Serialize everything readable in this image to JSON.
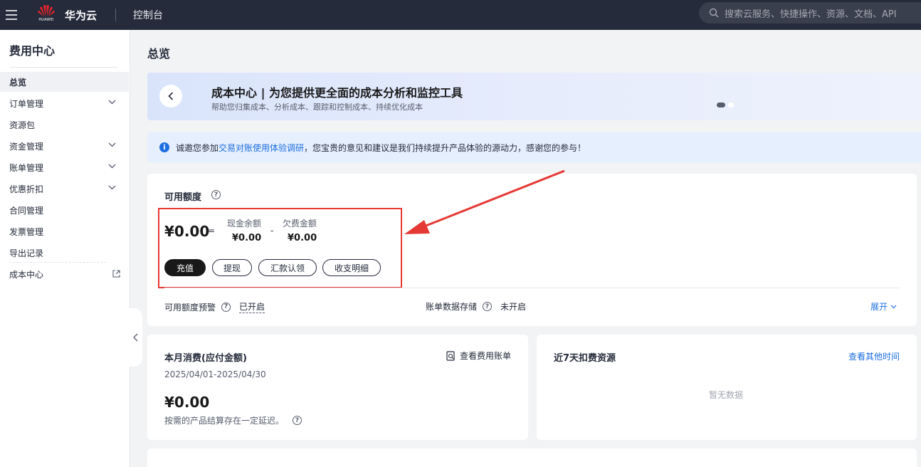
{
  "topbar": {
    "logo_text": "HUAWEI",
    "brand": "华为云",
    "console": "控制台",
    "search_placeholder": "搜索云服务、快捷操作、资源、文档、API"
  },
  "sidebar": {
    "title": "费用中心",
    "items": [
      {
        "label": "总览",
        "active": true,
        "expandable": false
      },
      {
        "label": "订单管理",
        "expandable": true
      },
      {
        "label": "资源包",
        "expandable": false
      },
      {
        "label": "资金管理",
        "expandable": true
      },
      {
        "label": "账单管理",
        "expandable": true
      },
      {
        "label": "优惠折扣",
        "expandable": true
      },
      {
        "label": "合同管理",
        "expandable": false
      },
      {
        "label": "发票管理",
        "expandable": false
      },
      {
        "label": "导出记录",
        "expandable": false
      },
      {
        "label": "成本中心",
        "external": true
      }
    ]
  },
  "main": {
    "page_title": "总览",
    "banner": {
      "title": "成本中心 | 为您提供更全面的成本分析和监控工具",
      "subtitle": "帮助您归集成本、分析成本、跟踪和控制成本、持续优化成本"
    },
    "notice": {
      "prefix": "诚邀您参加",
      "link": "交易对账使用体验调研",
      "suffix": "，您宝贵的意见和建议是我们持续提升产品体验的源动力，感谢您的参与！"
    },
    "available": {
      "title": "可用额度",
      "amount": "¥0.00",
      "equals": "=",
      "minus": "-",
      "cash_label": "现金余额",
      "cash_value": "¥0.00",
      "debt_label": "欠费金额",
      "debt_value": "¥0.00",
      "buttons": [
        "充值",
        "提现",
        "汇款认领",
        "收支明细"
      ],
      "alert_label": "可用额度预警",
      "alert_value": "已开启",
      "storage_label": "账单数据存储",
      "storage_value": "未开启",
      "expand": "展开"
    },
    "monthly": {
      "title": "本月消费(应付金额)",
      "view_bill": "查看费用账单",
      "period": "2025/04/01-2025/04/30",
      "amount": "¥0.00",
      "note": "按需的产品结算存在一定延迟。"
    },
    "recent": {
      "title": "近7天扣费资源",
      "link": "查看其他时间",
      "empty": "暂无数据"
    }
  },
  "colors": {
    "topbar": "#252b3a",
    "accent": "#1e6fe1",
    "highlight": "#e53935",
    "logo_red": "#e8242a"
  }
}
